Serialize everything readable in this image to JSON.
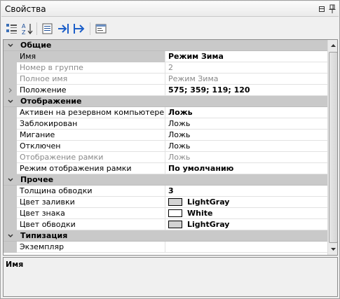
{
  "window": {
    "title": "Свойства"
  },
  "toolbar": {
    "buttons": [
      {
        "name": "categorized-view-button",
        "icon": "categorized-icon"
      },
      {
        "name": "alphabetical-sort-button",
        "icon": "sort-az-icon"
      },
      {
        "name": "property-pages-button",
        "icon": "list-icon"
      },
      {
        "name": "goto-button",
        "icon": "arrow-right-bar-icon"
      },
      {
        "name": "goto-end-button",
        "icon": "arrow-double-right-icon"
      },
      {
        "name": "properties-window-button",
        "icon": "window-icon"
      }
    ]
  },
  "grid": {
    "categories": [
      {
        "label": "Общие",
        "rows": [
          {
            "name": "Имя",
            "value": "Режим Зима",
            "bold": true,
            "selected": true
          },
          {
            "name": "Номер в группе",
            "value": "2",
            "disabled": true
          },
          {
            "name": "Полное имя",
            "value": "Режим Зима",
            "disabled": true
          },
          {
            "name": "Положение",
            "value": "575; 359; 119; 120",
            "bold": true,
            "expandable": true
          }
        ]
      },
      {
        "label": "Отображение",
        "rows": [
          {
            "name": "Активен на резервном компьютере",
            "value": "Ложь",
            "bold": true
          },
          {
            "name": "Заблокирован",
            "value": "Ложь"
          },
          {
            "name": "Мигание",
            "value": "Ложь"
          },
          {
            "name": "Отключен",
            "value": "Ложь"
          },
          {
            "name": "Отображение рамки",
            "value": "Ложь",
            "disabled": true
          },
          {
            "name": "Режим отображения рамки",
            "value": "По умолчанию",
            "bold": true
          }
        ]
      },
      {
        "label": "Прочее",
        "rows": [
          {
            "name": "Толщина обводки",
            "value": "3",
            "bold": true
          },
          {
            "name": "Цвет заливки",
            "value": "LightGray",
            "bold": true,
            "swatch": "#d3d3d3"
          },
          {
            "name": "Цвет знака",
            "value": "White",
            "bold": true,
            "swatch": "#ffffff"
          },
          {
            "name": "Цвет обводки",
            "value": "LightGray",
            "bold": true,
            "swatch": "#d3d3d3"
          }
        ]
      },
      {
        "label": "Типизация",
        "rows": [
          {
            "name": "Экземпляр",
            "value": ""
          }
        ]
      }
    ]
  },
  "description": {
    "title": "Имя"
  },
  "colors": {
    "category_bg": "#c9c9c9",
    "disabled_text": "#8a8a8a",
    "border": "#8c8c8c"
  }
}
